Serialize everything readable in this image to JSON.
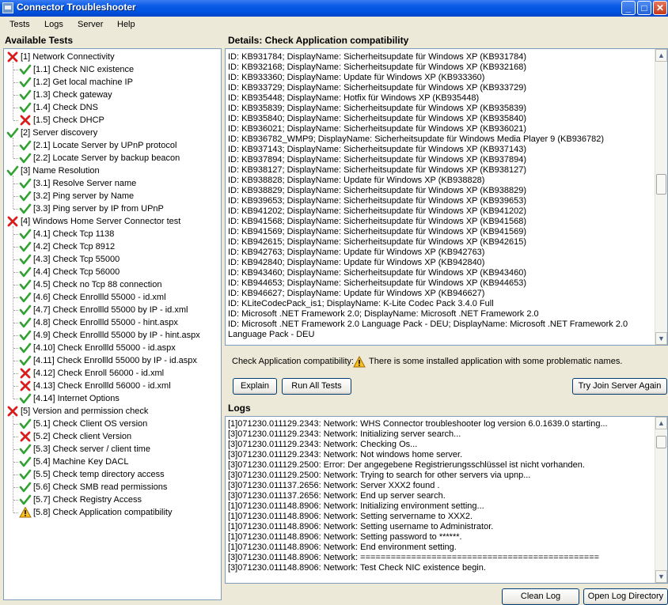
{
  "window": {
    "title": "Connector Troubleshooter",
    "controls": {
      "minimize": "_",
      "maximize": "□",
      "close": "✕"
    }
  },
  "menu": [
    "Tests",
    "Logs",
    "Server",
    "Help"
  ],
  "left": {
    "heading": "Available Tests",
    "tests": [
      {
        "label": "[1] Network Connectivity",
        "status": "fail",
        "level": 0
      },
      {
        "label": "[1.1] Check NIC existence",
        "status": "pass",
        "level": 1
      },
      {
        "label": "[1.2] Get local machine IP",
        "status": "pass",
        "level": 1
      },
      {
        "label": "[1.3] Check gateway",
        "status": "pass",
        "level": 1
      },
      {
        "label": "[1.4] Check DNS",
        "status": "pass",
        "level": 1
      },
      {
        "label": "[1.5] Check DHCP",
        "status": "fail",
        "level": 1
      },
      {
        "label": "[2] Server discovery",
        "status": "pass",
        "level": 0
      },
      {
        "label": "[2.1] Locate Server by UPnP protocol",
        "status": "pass",
        "level": 1
      },
      {
        "label": "[2.2] Locate Server by backup beacon",
        "status": "pass",
        "level": 1
      },
      {
        "label": "[3] Name Resolution",
        "status": "pass",
        "level": 0
      },
      {
        "label": "[3.1] Resolve Server name",
        "status": "pass",
        "level": 1
      },
      {
        "label": "[3.2] Ping server by Name",
        "status": "pass",
        "level": 1
      },
      {
        "label": "[3.3] Ping server by IP from UPnP",
        "status": "pass",
        "level": 1
      },
      {
        "label": "[4] Windows Home Server Connector test",
        "status": "fail",
        "level": 0
      },
      {
        "label": "[4.1] Check Tcp 1138",
        "status": "pass",
        "level": 1
      },
      {
        "label": "[4.2] Check Tcp 8912",
        "status": "pass",
        "level": 1
      },
      {
        "label": "[4.3] Check Tcp 55000",
        "status": "pass",
        "level": 1
      },
      {
        "label": "[4.4] Check Tcp 56000",
        "status": "pass",
        "level": 1
      },
      {
        "label": "[4.5] Check no Tcp 88 connection",
        "status": "pass",
        "level": 1
      },
      {
        "label": "[4.6] Check Enrollld 55000 - id.xml",
        "status": "pass",
        "level": 1
      },
      {
        "label": "[4.7] Check Enrollld 55000 by IP - id.xml",
        "status": "pass",
        "level": 1
      },
      {
        "label": "[4.8] Check Enrollld 55000 - hint.aspx",
        "status": "pass",
        "level": 1
      },
      {
        "label": "[4.9] Check Enrollld 55000 by IP - hint.aspx",
        "status": "pass",
        "level": 1
      },
      {
        "label": "[4.10] Check Enrollld 55000 - id.aspx",
        "status": "pass",
        "level": 1
      },
      {
        "label": "[4.11] Check Enrollld 55000 by IP - id.aspx",
        "status": "pass",
        "level": 1
      },
      {
        "label": "[4.12] Check Enroll 56000 - id.xml",
        "status": "fail",
        "level": 1
      },
      {
        "label": "[4.13] Check Enrollld 56000 - id.xml",
        "status": "fail",
        "level": 1
      },
      {
        "label": "[4.14] Internet Options",
        "status": "pass",
        "level": 1
      },
      {
        "label": "[5] Version and permission check",
        "status": "fail",
        "level": 0
      },
      {
        "label": "[5.1] Check Client OS version",
        "status": "pass",
        "level": 1
      },
      {
        "label": "[5.2] Check client Version",
        "status": "fail",
        "level": 1
      },
      {
        "label": "[5.3] Check server / client time",
        "status": "pass",
        "level": 1
      },
      {
        "label": "[5.4] Machine Key DACL",
        "status": "pass",
        "level": 1
      },
      {
        "label": "[5.5] Check temp directory access",
        "status": "pass",
        "level": 1
      },
      {
        "label": "[5.6] Check SMB read permissions",
        "status": "pass",
        "level": 1
      },
      {
        "label": "[5.7] Check Registry Access",
        "status": "pass",
        "level": 1
      },
      {
        "label": "[5.8] Check Application compatibility",
        "status": "warn",
        "level": 1
      }
    ]
  },
  "details": {
    "heading": "Details: Check Application compatibility",
    "lines": [
      "ID: KB931784; DisplayName: Sicherheitsupdate für Windows XP (KB931784)",
      "ID: KB932168; DisplayName: Sicherheitsupdate für Windows XP (KB932168)",
      "ID: KB933360; DisplayName: Update für Windows XP (KB933360)",
      "ID: KB933729; DisplayName: Sicherheitsupdate für Windows XP (KB933729)",
      "ID: KB935448; DisplayName: Hotfix für Windows XP (KB935448)",
      "ID: KB935839; DisplayName: Sicherheitsupdate für Windows XP (KB935839)",
      "ID: KB935840; DisplayName: Sicherheitsupdate für Windows XP (KB935840)",
      "ID: KB936021; DisplayName: Sicherheitsupdate für Windows XP (KB936021)",
      "ID: KB936782_WMP9; DisplayName: Sicherheitsupdate für Windows Media Player 9 (KB936782)",
      "ID: KB937143; DisplayName: Sicherheitsupdate für Windows XP (KB937143)",
      "ID: KB937894; DisplayName: Sicherheitsupdate für Windows XP (KB937894)",
      "ID: KB938127; DisplayName: Sicherheitsupdate für Windows XP (KB938127)",
      "ID: KB938828; DisplayName: Update für Windows XP (KB938828)",
      "ID: KB938829; DisplayName: Sicherheitsupdate für Windows XP (KB938829)",
      "ID: KB939653; DisplayName: Sicherheitsupdate für Windows XP (KB939653)",
      "ID: KB941202; DisplayName: Sicherheitsupdate für Windows XP (KB941202)",
      "ID: KB941568; DisplayName: Sicherheitsupdate für Windows XP (KB941568)",
      "ID: KB941569; DisplayName: Sicherheitsupdate für Windows XP (KB941569)",
      "ID: KB942615; DisplayName: Sicherheitsupdate für Windows XP (KB942615)",
      "ID: KB942763; DisplayName: Update für Windows XP (KB942763)",
      "ID: KB942840; DisplayName: Update für Windows XP (KB942840)",
      "ID: KB943460; DisplayName: Sicherheitsupdate für Windows XP (KB943460)",
      "ID: KB944653; DisplayName: Sicherheitsupdate für Windows XP (KB944653)",
      "ID: KB946627; DisplayName: Update für Windows XP (KB946627)",
      "ID: KLiteCodecPack_is1; DisplayName: K-Lite Codec Pack 3.4.0 Full",
      "ID: Microsoft .NET Framework 2.0; DisplayName: Microsoft .NET Framework 2.0",
      "ID: Microsoft .NET Framework 2.0 Language Pack - DEU; DisplayName: Microsoft .NET Framework 2.0",
      "Language Pack - DEU"
    ],
    "scroll_position": 0.45
  },
  "status": {
    "label": "Check Application compatibility:",
    "message": "There is some installed application with some problematic names."
  },
  "buttons": {
    "explain": "Explain",
    "run_all": "Run All Tests",
    "try_join": "Try Join Server Again"
  },
  "logs": {
    "heading": "Logs",
    "lines": [
      "[1]071230.011129.2343: Network: WHS Connector troubleshooter log version 6.0.1639.0 starting...",
      "[3]071230.011129.2343: Network: Initializing server search...",
      "[3]071230.011129.2343: Network: Checking Os...",
      "[3]071230.011129.2343: Network: Not windows home server.",
      "[3]071230.011129.2500: Error: Der angegebene Registrierungsschlüssel ist nicht vorhanden.",
      "[3]071230.011129.2500: Network: Trying to search for other servers via upnp...",
      "[3]071230.011137.2656: Network: Server XXX2 found .",
      "[3]071230.011137.2656: Network: End up server search.",
      "[1]071230.011148.8906: Network: Initializing environment setting...",
      "[1]071230.011148.8906: Network: Setting servername to XXX2.",
      "[1]071230.011148.8906: Network: Setting username to Administrator.",
      "[1]071230.011148.8906: Network: Setting password to ******.",
      "[1]071230.011148.8906: Network: End environment setting.",
      "[3]071230.011148.8906: Network: ===============================================",
      "[3]071230.011148.8906: Network: Test Check NIC existence begin."
    ],
    "scroll_position": 0.05
  },
  "log_buttons": {
    "clean": "Clean Log",
    "open_dir": "Open Log Directory"
  }
}
